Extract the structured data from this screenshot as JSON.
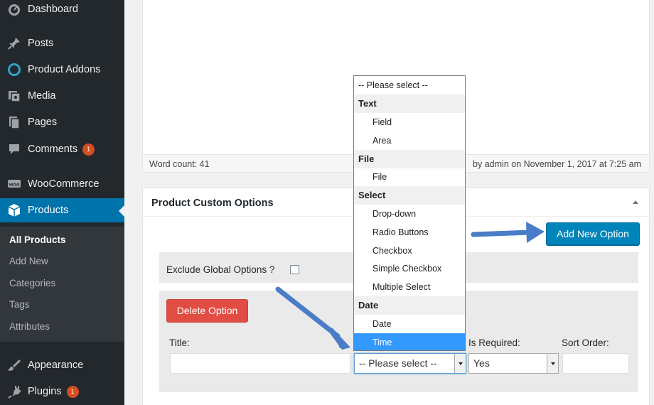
{
  "sidebar": {
    "items": [
      {
        "label": "Dashboard",
        "icon": "dashboard-icon"
      },
      {
        "label": "Posts",
        "icon": "pin-icon"
      },
      {
        "label": "Product Addons",
        "icon": "addons-ring-icon"
      },
      {
        "label": "Media",
        "icon": "media-icon"
      },
      {
        "label": "Pages",
        "icon": "pages-icon"
      },
      {
        "label": "Comments",
        "icon": "comment-icon",
        "badge": "1"
      },
      {
        "label": "WooCommerce",
        "icon": "woo-icon"
      },
      {
        "label": "Products",
        "icon": "box-icon"
      },
      {
        "label": "Appearance",
        "icon": "brush-icon"
      },
      {
        "label": "Plugins",
        "icon": "plug-icon",
        "badge": "1"
      }
    ],
    "submenu": [
      "All Products",
      "Add New",
      "Categories",
      "Tags",
      "Attributes"
    ]
  },
  "editor": {
    "word_count": "Word count: 41",
    "last_edited": "by admin on November 1, 2017 at 7:25 am"
  },
  "options_box": {
    "title": "Product Custom Options",
    "add_new_label": "Add New Option",
    "exclude_label": "Exclude Global Options ?",
    "exclude_checked": false,
    "delete_label": "Delete Option",
    "fields": {
      "title_label": "Title:",
      "title_value": "",
      "type_value": "-- Please select --",
      "required_label": "Is Required:",
      "required_value": "Yes",
      "sort_label": "Sort Order:",
      "sort_value": ""
    }
  },
  "dropdown": {
    "placeholder": "-- Please select --",
    "groups": [
      {
        "label": "Text",
        "options": [
          "Field",
          "Area"
        ]
      },
      {
        "label": "File",
        "options": [
          "File"
        ]
      },
      {
        "label": "Select",
        "options": [
          "Drop-down",
          "Radio Buttons",
          "Checkbox",
          "Simple Checkbox",
          "Multiple Select"
        ]
      },
      {
        "label": "Date",
        "options": [
          "Date",
          "Time"
        ]
      }
    ],
    "highlighted": "Time"
  },
  "colors": {
    "sidebar_bg": "#23282d",
    "active_blue": "#0073aa",
    "button_primary": "#0085ba",
    "delete_red": "#e14d43",
    "annotation_arrow": "#4a7cc7"
  }
}
